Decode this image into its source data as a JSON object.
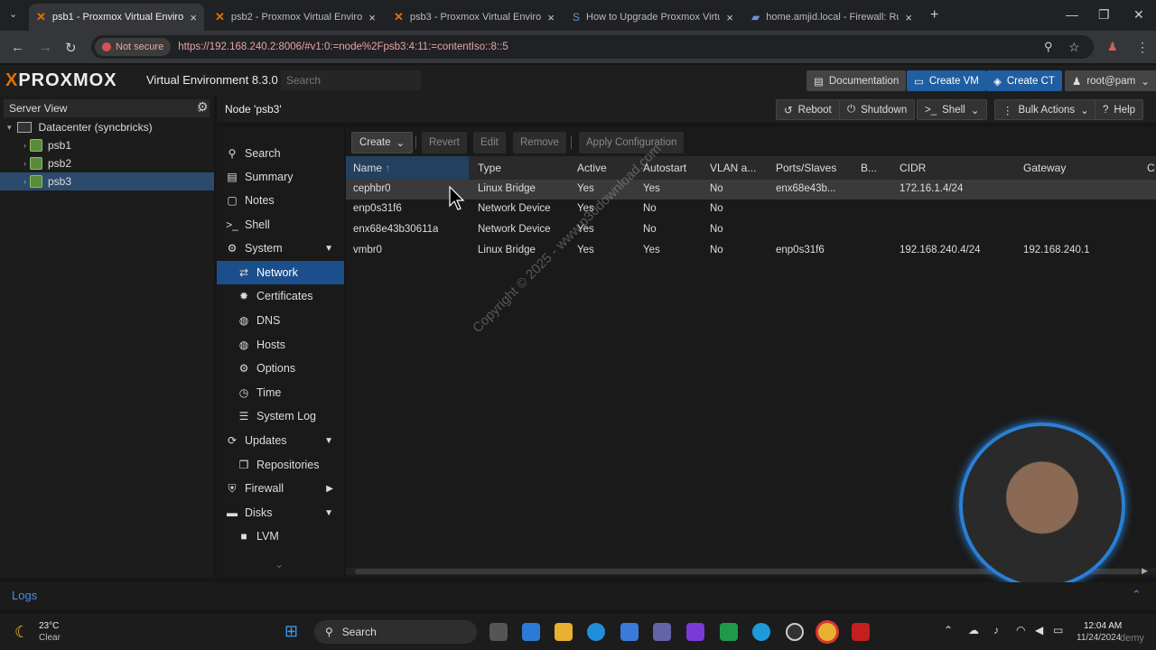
{
  "browser": {
    "tabs": [
      {
        "title": "psb1 - Proxmox Virtual Environ",
        "active": true
      },
      {
        "title": "psb2 - Proxmox Virtual Environ",
        "active": false
      },
      {
        "title": "psb3 - Proxmox Virtual Environ",
        "active": false
      },
      {
        "title": "How to Upgrade Proxmox Virtu",
        "active": false
      },
      {
        "title": "home.amjid.local - Firewall: Rul",
        "active": false
      }
    ],
    "not_secure": "Not secure",
    "url": "https://192.168.240.2:8006/#v1:0:=node%2Fpsb3:4:11:=contentIso::8::5"
  },
  "pve": {
    "logo": "PROXMOX",
    "version": "Virtual Environment 8.3.0",
    "search_placeholder": "Search",
    "buttons": {
      "docs": "Documentation",
      "create_vm": "Create VM",
      "create_ct": "Create CT",
      "user": "root@pam"
    }
  },
  "tree": {
    "view": "Server View",
    "datacenter": "Datacenter (syncbricks)",
    "nodes": [
      "psb1",
      "psb2",
      "psb3"
    ]
  },
  "node": {
    "title": "Node 'psb3'",
    "actions": {
      "reboot": "Reboot",
      "shutdown": "Shutdown",
      "shell": "Shell",
      "bulk": "Bulk Actions",
      "help": "Help"
    }
  },
  "menu": [
    {
      "label": "Search",
      "icon": "search-icon",
      "glyph": "⚲"
    },
    {
      "label": "Summary",
      "icon": "book-icon",
      "glyph": "▤"
    },
    {
      "label": "Notes",
      "icon": "notes-icon",
      "glyph": "▢"
    },
    {
      "label": "Shell",
      "icon": "terminal-icon",
      "glyph": ">_"
    },
    {
      "label": "System",
      "icon": "cogs-icon",
      "glyph": "⚙"
    },
    {
      "label": "Network",
      "icon": "exchange-icon",
      "glyph": "⇄"
    },
    {
      "label": "Certificates",
      "icon": "certificate-icon",
      "glyph": "✹"
    },
    {
      "label": "DNS",
      "icon": "globe-icon",
      "glyph": "◍"
    },
    {
      "label": "Hosts",
      "icon": "globe-icon",
      "glyph": "◍"
    },
    {
      "label": "Options",
      "icon": "gear-icon",
      "glyph": "⚙"
    },
    {
      "label": "Time",
      "icon": "clock-icon",
      "glyph": "◷"
    },
    {
      "label": "System Log",
      "icon": "list-icon",
      "glyph": "☰"
    },
    {
      "label": "Updates",
      "icon": "refresh-icon",
      "glyph": "⟳"
    },
    {
      "label": "Repositories",
      "icon": "files-icon",
      "glyph": "❐"
    },
    {
      "label": "Firewall",
      "icon": "shield-icon",
      "glyph": "⛨"
    },
    {
      "label": "Disks",
      "icon": "hdd-icon",
      "glyph": "▬"
    },
    {
      "label": "LVM",
      "icon": "square-icon",
      "glyph": "■"
    }
  ],
  "toolbar": {
    "create": "Create",
    "revert": "Revert",
    "edit": "Edit",
    "remove": "Remove",
    "apply": "Apply Configuration"
  },
  "columns": [
    "Name",
    "Type",
    "Active",
    "Autostart",
    "VLAN a...",
    "Ports/Slaves",
    "B...",
    "CIDR",
    "Gateway",
    "C"
  ],
  "rows": [
    [
      "cephbr0",
      "Linux Bridge",
      "Yes",
      "Yes",
      "No",
      "enx68e43b...",
      "",
      "172.16.1.4/24",
      ""
    ],
    [
      "enp0s31f6",
      "Network Device",
      "Yes",
      "No",
      "No",
      "",
      "",
      "",
      ""
    ],
    [
      "enx68e43b30611a",
      "Network Device",
      "Yes",
      "No",
      "No",
      "",
      "",
      "",
      ""
    ],
    [
      "vmbr0",
      "Linux Bridge",
      "Yes",
      "Yes",
      "No",
      "enp0s31f6",
      "",
      "192.168.240.4/24",
      "192.168.240.1"
    ]
  ],
  "watermark": "Copyright © 2025 - www.p30download.com",
  "logs": "Logs",
  "taskbar": {
    "temp": "23°C",
    "weather": "Clear",
    "search": "Search",
    "time": "12:04 AM",
    "date": "11/24/2024",
    "brand": "demy"
  }
}
